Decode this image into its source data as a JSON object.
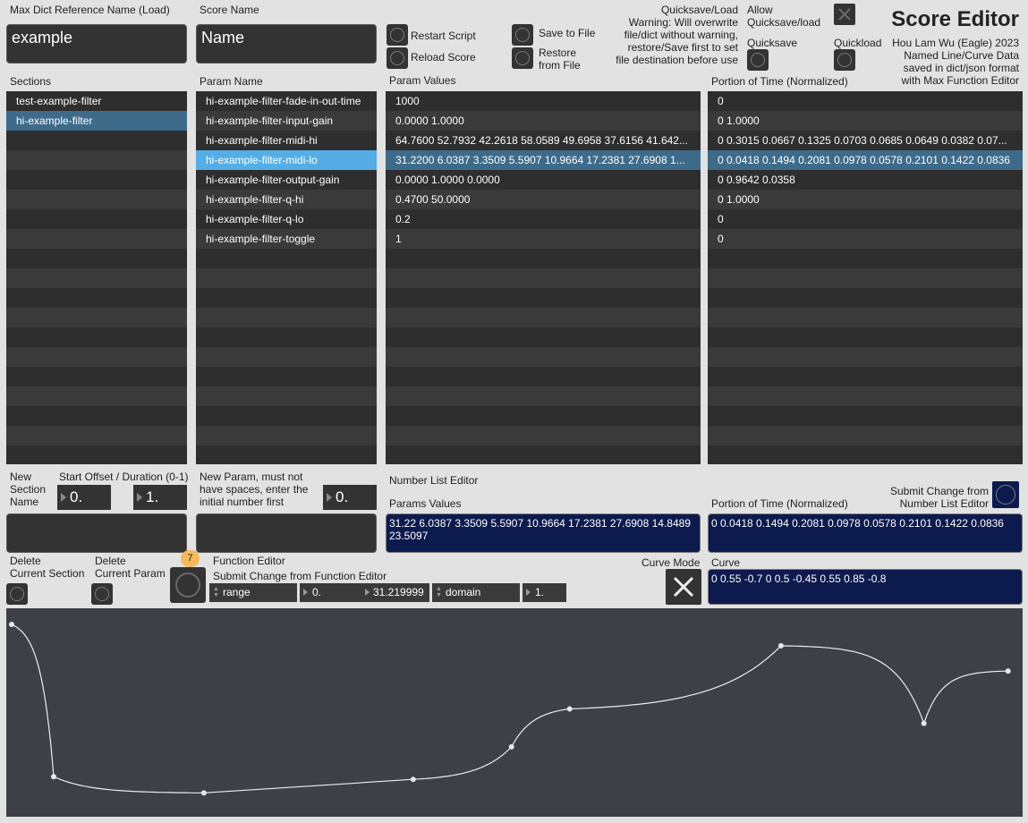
{
  "app_title": "Score Editor",
  "author": "Hou Lam Wu (Eagle) 2023",
  "description": "Named Line/Curve Data\nsaved in dict/json format\nwith Max Function Editor",
  "labels": {
    "dict_ref": "Max Dict Reference Name (Load)",
    "score_name": "Score Name",
    "restart_script": "Restart Script",
    "reload_score": "Reload Score",
    "save_to_file": "Save to File",
    "restore_from_file": "Restore\nfrom File",
    "quicksave_warning": "Quicksave/Load\nWarning: Will overwrite\nfile/dict without warning,\nrestore/Save first to set\nfile destination before use",
    "allow_quicksave": "Allow\nQuicksave/load",
    "quicksave": "Quicksave",
    "quickload": "Quickload",
    "sections": "Sections",
    "param_name": "Param Name",
    "param_values": "Param Values",
    "portion_of_time": "Portion of Time (Normalized)",
    "new_section_name": "New\nSection\nName",
    "start_offset": "Start Offset / Duration (0-1)",
    "new_param": "New Param, must not\nhave spaces, enter the\ninitial number first",
    "number_list_editor": "Number List Editor",
    "params_values": "Params Values",
    "portion_of_time_2": "Portion of Time (Normalized)",
    "submit_number_list": "Submit Change from\nNumber List Editor",
    "delete_section": "Delete\nCurrent Section",
    "delete_param": "Delete\nCurrent Param",
    "function_editor": "Function Editor",
    "submit_function": "Submit Change from Function Editor",
    "curve_mode": "Curve Mode",
    "curve": "Curve"
  },
  "inputs": {
    "dict_ref_value": "example",
    "score_name_value": "Name",
    "start_offset": "0.",
    "duration": "1.",
    "new_param_initial": "0."
  },
  "sections": [
    "test-example-filter",
    "hi-example-filter"
  ],
  "params": [
    {
      "name": "hi-example-filter-fade-in-out-time",
      "values": "1000",
      "time": "0"
    },
    {
      "name": "hi-example-filter-input-gain",
      "values": "0.0000 1.0000",
      "time": "0 1.0000"
    },
    {
      "name": "hi-example-filter-midi-hi",
      "values": "64.7600 52.7932 42.2618 58.0589 49.6958 37.6156 41.642...",
      "time": "0 0.3015 0.0667 0.1325 0.0703 0.0685 0.0649 0.0382 0.07..."
    },
    {
      "name": "hi-example-filter-midi-lo",
      "values": "31.2200 6.0387 3.3509 5.5907 10.9664 17.2381 27.6908 1...",
      "time": "0 0.0418 0.1494 0.2081 0.0978 0.0578 0.2101 0.1422 0.0836"
    },
    {
      "name": "hi-example-filter-output-gain",
      "values": "0.0000 1.0000 0.0000",
      "time": "0 0.9642 0.0358"
    },
    {
      "name": "hi-example-filter-q-hi",
      "values": "0.4700 50.0000",
      "time": "0 1.0000"
    },
    {
      "name": "hi-example-filter-q-lo",
      "values": "0.2",
      "time": "0"
    },
    {
      "name": "hi-example-filter-toggle",
      "values": "1",
      "time": "0"
    }
  ],
  "selected_section": 1,
  "selected_param": 3,
  "number_list": {
    "params_values": "31.22 6.0387 3.3509 5.5907 10.9664 17.2381 27.6908 14.8489 23.5097",
    "portion_of_time": "0 0.0418 0.1494 0.2081 0.0978 0.0578 0.2101 0.1422 0.0836"
  },
  "function_editor": {
    "badge": "7",
    "range_label": "range",
    "range_min": "0.",
    "range_max": "31.219999",
    "domain_label": "domain",
    "domain_min": "0.",
    "domain_max": "1."
  },
  "curve_value": "0 0.55 -0.7 0 0.5 -0.45 0.55 0.85 -0.8",
  "curve_points": [
    {
      "x": 0.0,
      "y": 31.22
    },
    {
      "x": 0.0418,
      "y": 6.0387
    },
    {
      "x": 0.1912,
      "y": 3.3509
    },
    {
      "x": 0.3993,
      "y": 5.5907
    },
    {
      "x": 0.4971,
      "y": 10.9664
    },
    {
      "x": 0.5549,
      "y": 17.2381
    },
    {
      "x": 0.765,
      "y": 27.6908
    },
    {
      "x": 0.9072,
      "y": 14.8489
    },
    {
      "x": 0.9908,
      "y": 23.5097
    }
  ],
  "colors": {
    "background": "#e2e2e2",
    "list_bg": "#2e2e2e",
    "list_alt": "#3a3a3a",
    "selected_dark": "#3e6b8a",
    "selected_light": "#54aee5",
    "message_box": "#0c1a4d",
    "function_bg": "#3d4047",
    "badge": "#f5b85a"
  }
}
